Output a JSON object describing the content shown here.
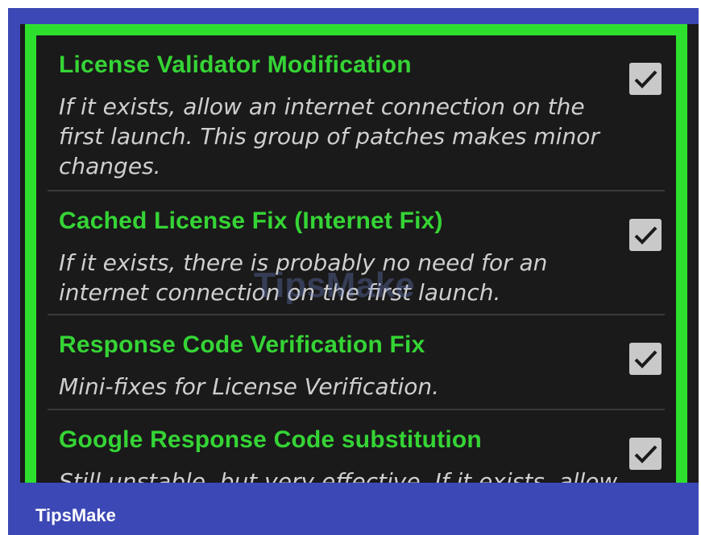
{
  "items": [
    {
      "title": "License Validator Modification",
      "desc_lines": [
        "If it exists, allow an internet connection on the",
        "first launch. This group of patches makes minor",
        "changes."
      ],
      "checked": true
    },
    {
      "title": "Cached License Fix (Internet Fix)",
      "desc_lines": [
        "If it exists, there is probably no need for an",
        "internet connection on the first launch."
      ],
      "checked": true
    },
    {
      "title": "Response Code Verification Fix",
      "desc_lines": [
        "Mini-fixes for License Verification."
      ],
      "checked": true
    },
    {
      "title": "Google Response Code substitution",
      "desc_lines": [
        "Still unstable, but very effective. If it exists, allow"
      ],
      "checked": true
    }
  ],
  "watermark": "TipsMake",
  "footer": {
    "brand": "TipsMake"
  },
  "colors": {
    "frame_blue": "#3c48b5",
    "accent_green": "#2ee02e",
    "title_green": "#35d435"
  }
}
